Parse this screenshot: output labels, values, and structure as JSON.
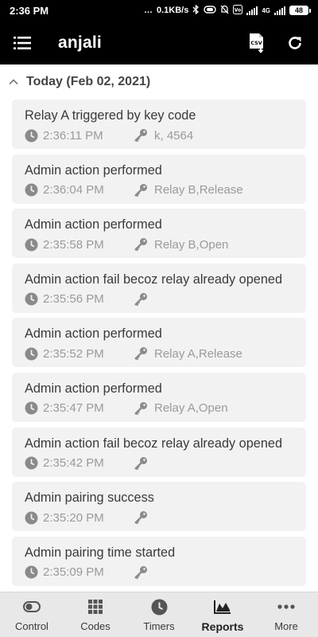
{
  "status_bar": {
    "time": "2:36 PM",
    "net_speed": "0.1KB/s",
    "network_type": "4G",
    "battery": "48"
  },
  "app_bar": {
    "title": "anjali",
    "menu_icon": "menu-icon",
    "export_icon": "csv-export-icon",
    "refresh_icon": "refresh-icon"
  },
  "section": {
    "title": "Today (Feb 02, 2021)"
  },
  "events": [
    {
      "title": "Relay A triggered by key code",
      "time": "2:36:11 PM",
      "detail": "k, 4564"
    },
    {
      "title": "Admin action performed",
      "time": "2:36:04 PM",
      "detail": "Relay B,Release"
    },
    {
      "title": "Admin action performed",
      "time": "2:35:58 PM",
      "detail": "Relay B,Open"
    },
    {
      "title": "Admin action fail becoz relay already opened",
      "time": "2:35:56 PM",
      "detail": ""
    },
    {
      "title": "Admin action performed",
      "time": "2:35:52 PM",
      "detail": "Relay A,Release"
    },
    {
      "title": "Admin action performed",
      "time": "2:35:47 PM",
      "detail": "Relay A,Open"
    },
    {
      "title": "Admin action fail becoz relay already opened",
      "time": "2:35:42 PM",
      "detail": ""
    },
    {
      "title": "Admin pairing success",
      "time": "2:35:20 PM",
      "detail": ""
    },
    {
      "title": "Admin pairing time started",
      "time": "2:35:09 PM",
      "detail": ""
    }
  ],
  "bottom_nav": {
    "items": [
      {
        "label": "Control",
        "icon": "toggle-icon"
      },
      {
        "label": "Codes",
        "icon": "keypad-icon"
      },
      {
        "label": "Timers",
        "icon": "clock-icon"
      },
      {
        "label": "Reports",
        "icon": "chart-icon"
      },
      {
        "label": "More",
        "icon": "more-dots-icon"
      }
    ],
    "active": "Reports"
  },
  "colors": {
    "app_bar_bg": "#000000",
    "card_bg": "#f2f2f2",
    "muted_text": "#9a9a9a",
    "nav_bg": "#e8e8e8"
  }
}
